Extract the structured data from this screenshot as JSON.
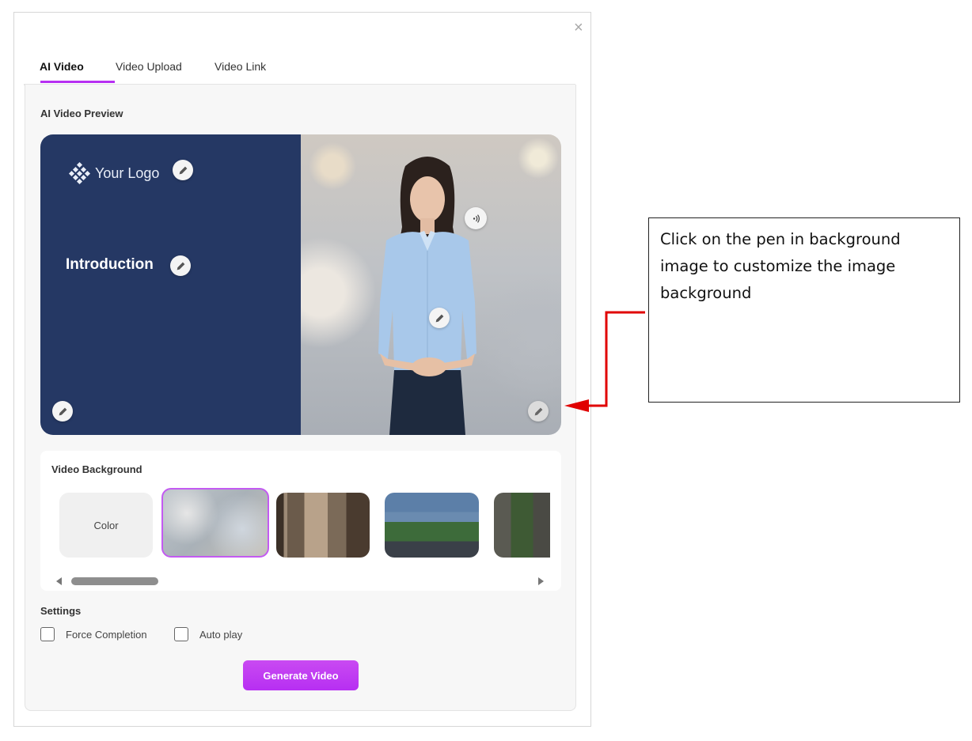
{
  "dialog": {
    "close_label": "×",
    "tabs": [
      {
        "label": "AI Video",
        "active": true
      },
      {
        "label": "Video Upload",
        "active": false
      },
      {
        "label": "Video Link",
        "active": false
      }
    ],
    "accent_color": "#b72ff2"
  },
  "preview": {
    "heading": "AI Video Preview",
    "logo_text": "Your Logo",
    "title_text": "Introduction",
    "left_panel_color": "#253864",
    "icons": [
      "pencil-icon",
      "voice-icon"
    ]
  },
  "background_picker": {
    "heading": "Video Background",
    "color_option_label": "Color",
    "thumbnails": [
      "blurred-office",
      "hallway",
      "building-with-trees",
      "garden-wall"
    ],
    "selected_index": 1
  },
  "settings": {
    "heading": "Settings",
    "force_completion_label": "Force Completion",
    "force_completion_checked": false,
    "auto_play_label": "Auto play",
    "auto_play_checked": false
  },
  "generate_button_label": "Generate Video",
  "annotation": {
    "text": "Click on the pen in background image to customize the image background",
    "arrow_color": "#e00000"
  }
}
